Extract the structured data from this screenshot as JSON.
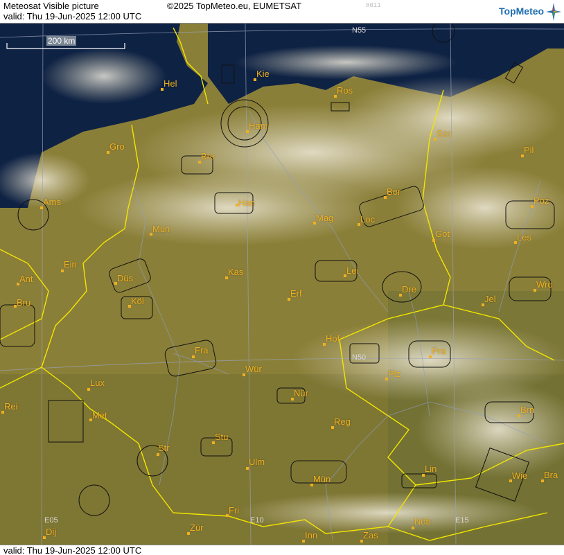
{
  "header": {
    "title": "Meteosat Visible picture",
    "valid": "valid:  Thu  19-Jun-2025  12:00 UTC",
    "copyright": "©2025 TopMeteo.eu, EUMETSAT",
    "code": "8011",
    "logo": "TopMeteo",
    "logo_icon": "compass-star-icon"
  },
  "footer": {
    "valid": "valid:  Thu  19-Jun-2025  12:00 UTC"
  },
  "scale": {
    "label": "200 km"
  },
  "grid_labels": [
    "N55",
    "N50",
    "E05",
    "E10",
    "E15"
  ],
  "cities": [
    "Hel",
    "Kie",
    "Ros",
    "Ham",
    "Szc",
    "Gro",
    "Bre",
    "Pil",
    "Ams",
    "Han",
    "Ber",
    "Mün",
    "Mag",
    "Loc",
    "Poz",
    "Got",
    "Les",
    "Ein",
    "Kas",
    "Lei",
    "Ant",
    "Düs",
    "Wro",
    "Bru",
    "Köl",
    "Erf",
    "Dre",
    "Jel",
    "Hof",
    "Fra",
    "Pra",
    "Lux",
    "Wür",
    "Plz",
    "Nür",
    "Rei",
    "Met",
    "Reg",
    "Brn",
    "Stu",
    "Str",
    "Ulm",
    "Lin",
    "Mün",
    "Wie",
    "Bra",
    "Fri",
    "Dij",
    "Zür",
    "Inn",
    "Zas",
    "Nöb"
  ],
  "colors": {
    "border": "#f2e600",
    "label": "#f0b020",
    "sea": "#0e2244",
    "land": "#8a7f38",
    "grid": "#9aa3b8"
  }
}
